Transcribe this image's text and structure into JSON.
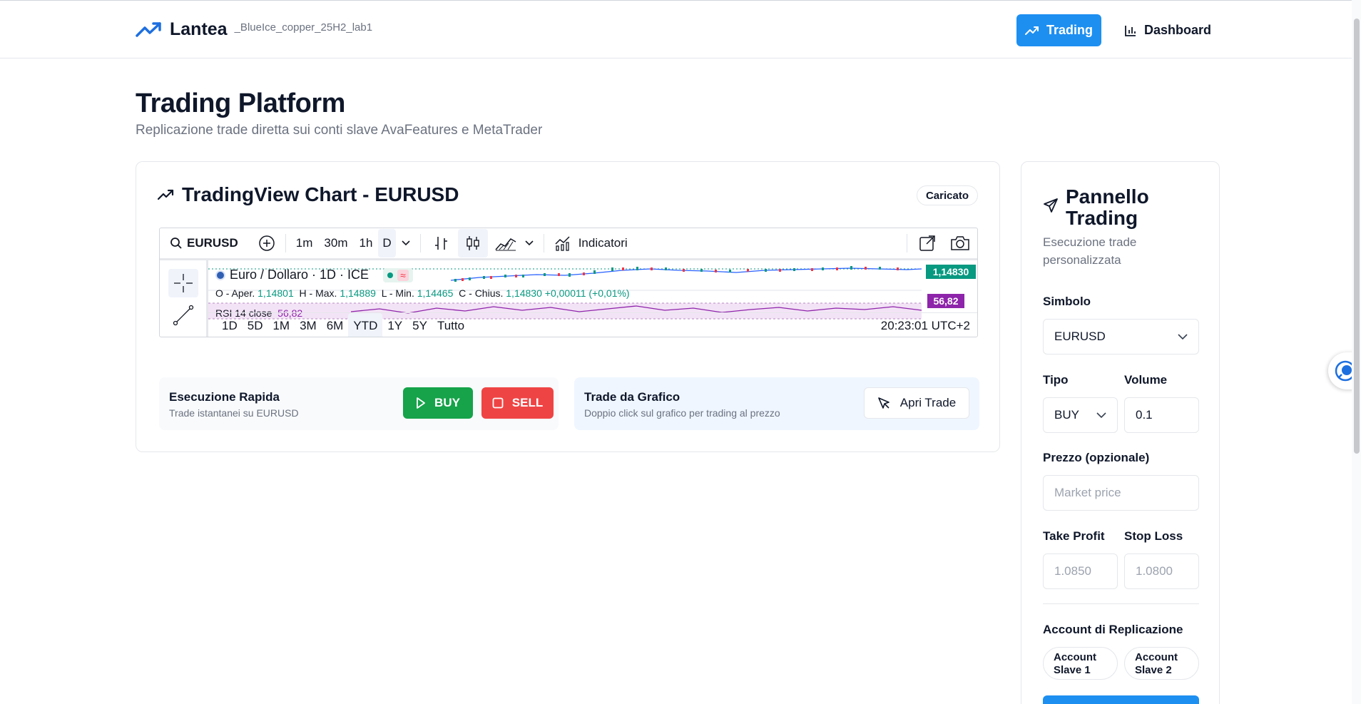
{
  "header": {
    "brand": "Lantea",
    "brand_sub": "_BlueIce_copper_25H2_lab1",
    "nav_trading": "Trading",
    "nav_dashboard": "Dashboard"
  },
  "page": {
    "title": "Trading Platform",
    "subtitle": "Replicazione trade diretta sui conti slave AvaFeatures e MetaTrader"
  },
  "chart_card": {
    "title": "TradingView Chart - EURUSD",
    "badge": "Caricato",
    "toolbar": {
      "symbol": "EURUSD",
      "intervals": [
        "1m",
        "30m",
        "1h",
        "D"
      ],
      "indicators": "Indicatori"
    },
    "legend": {
      "pair": "Euro / Dollaro · 1D · ICE",
      "open_label": "O - Aper.",
      "open": "1,14801",
      "high_label": "H - Max.",
      "high": "1,14889",
      "low_label": "L - Min.",
      "low": "1,14465",
      "close_label": "C - Chius.",
      "close": "1,14830",
      "change": "+0,00011 (+0,01%)",
      "rsi_label": "RSI 14 close",
      "rsi_value": "56,82"
    },
    "price_tag": "1,14830",
    "rsi_tag": "56,82",
    "ranges": [
      "1D",
      "5D",
      "1M",
      "3M",
      "6M",
      "YTD",
      "1Y",
      "5Y",
      "Tutto"
    ],
    "time": "20:23:01 UTC+2"
  },
  "quick_exec": {
    "title": "Esecuzione Rapida",
    "subtitle": "Trade istantanei su EURUSD",
    "buy": "BUY",
    "sell": "SELL"
  },
  "chart_trade": {
    "title": "Trade da Grafico",
    "subtitle": "Doppio click sul grafico per trading al prezzo",
    "button": "Apri Trade"
  },
  "panel": {
    "title_line1": "Pannello",
    "title_line2": "Trading",
    "subtitle": "Esecuzione trade personalizzata",
    "symbol_label": "Simbolo",
    "symbol_value": "EURUSD",
    "type_label": "Tipo",
    "type_value": "BUY",
    "volume_label": "Volume",
    "volume_value": "0.1",
    "price_label": "Prezzo (opzionale)",
    "price_placeholder": "Market price",
    "tp_label": "Take Profit",
    "tp_placeholder": "1.0850",
    "sl_label": "Stop Loss",
    "sl_placeholder": "1.0800",
    "accounts_label": "Account di Replicazione",
    "account1": "Account Slave 1",
    "account2": "Account Slave 2"
  },
  "colors": {
    "primary": "#1d8ff1",
    "buy": "#16a34a",
    "sell": "#ef4444",
    "tv_green": "#089981",
    "rsi_purple": "#8e24aa"
  },
  "icons": [
    "trending-up-icon",
    "bar-chart-icon",
    "search-icon",
    "plus-circle-icon",
    "candles-icon",
    "area-chart-icon",
    "indicators-icon",
    "popout-icon",
    "camera-icon",
    "crosshair-icon",
    "line-tool-icon",
    "play-icon",
    "stop-icon",
    "pointer-icon",
    "send-icon",
    "chevron-down-icon"
  ]
}
